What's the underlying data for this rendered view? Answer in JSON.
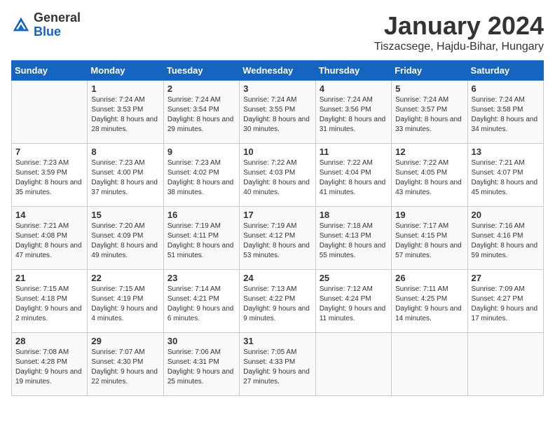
{
  "header": {
    "logo_line1": "General",
    "logo_line2": "Blue",
    "month": "January 2024",
    "location": "Tiszacsege, Hajdu-Bihar, Hungary"
  },
  "weekdays": [
    "Sunday",
    "Monday",
    "Tuesday",
    "Wednesday",
    "Thursday",
    "Friday",
    "Saturday"
  ],
  "weeks": [
    [
      null,
      {
        "day": "1",
        "sunrise": "Sunrise: 7:24 AM",
        "sunset": "Sunset: 3:53 PM",
        "daylight": "Daylight: 8 hours and 28 minutes."
      },
      {
        "day": "2",
        "sunrise": "Sunrise: 7:24 AM",
        "sunset": "Sunset: 3:54 PM",
        "daylight": "Daylight: 8 hours and 29 minutes."
      },
      {
        "day": "3",
        "sunrise": "Sunrise: 7:24 AM",
        "sunset": "Sunset: 3:55 PM",
        "daylight": "Daylight: 8 hours and 30 minutes."
      },
      {
        "day": "4",
        "sunrise": "Sunrise: 7:24 AM",
        "sunset": "Sunset: 3:56 PM",
        "daylight": "Daylight: 8 hours and 31 minutes."
      },
      {
        "day": "5",
        "sunrise": "Sunrise: 7:24 AM",
        "sunset": "Sunset: 3:57 PM",
        "daylight": "Daylight: 8 hours and 33 minutes."
      },
      {
        "day": "6",
        "sunrise": "Sunrise: 7:24 AM",
        "sunset": "Sunset: 3:58 PM",
        "daylight": "Daylight: 8 hours and 34 minutes."
      }
    ],
    [
      {
        "day": "7",
        "sunrise": "Sunrise: 7:23 AM",
        "sunset": "Sunset: 3:59 PM",
        "daylight": "Daylight: 8 hours and 35 minutes."
      },
      {
        "day": "8",
        "sunrise": "Sunrise: 7:23 AM",
        "sunset": "Sunset: 4:00 PM",
        "daylight": "Daylight: 8 hours and 37 minutes."
      },
      {
        "day": "9",
        "sunrise": "Sunrise: 7:23 AM",
        "sunset": "Sunset: 4:02 PM",
        "daylight": "Daylight: 8 hours and 38 minutes."
      },
      {
        "day": "10",
        "sunrise": "Sunrise: 7:22 AM",
        "sunset": "Sunset: 4:03 PM",
        "daylight": "Daylight: 8 hours and 40 minutes."
      },
      {
        "day": "11",
        "sunrise": "Sunrise: 7:22 AM",
        "sunset": "Sunset: 4:04 PM",
        "daylight": "Daylight: 8 hours and 41 minutes."
      },
      {
        "day": "12",
        "sunrise": "Sunrise: 7:22 AM",
        "sunset": "Sunset: 4:05 PM",
        "daylight": "Daylight: 8 hours and 43 minutes."
      },
      {
        "day": "13",
        "sunrise": "Sunrise: 7:21 AM",
        "sunset": "Sunset: 4:07 PM",
        "daylight": "Daylight: 8 hours and 45 minutes."
      }
    ],
    [
      {
        "day": "14",
        "sunrise": "Sunrise: 7:21 AM",
        "sunset": "Sunset: 4:08 PM",
        "daylight": "Daylight: 8 hours and 47 minutes."
      },
      {
        "day": "15",
        "sunrise": "Sunrise: 7:20 AM",
        "sunset": "Sunset: 4:09 PM",
        "daylight": "Daylight: 8 hours and 49 minutes."
      },
      {
        "day": "16",
        "sunrise": "Sunrise: 7:19 AM",
        "sunset": "Sunset: 4:11 PM",
        "daylight": "Daylight: 8 hours and 51 minutes."
      },
      {
        "day": "17",
        "sunrise": "Sunrise: 7:19 AM",
        "sunset": "Sunset: 4:12 PM",
        "daylight": "Daylight: 8 hours and 53 minutes."
      },
      {
        "day": "18",
        "sunrise": "Sunrise: 7:18 AM",
        "sunset": "Sunset: 4:13 PM",
        "daylight": "Daylight: 8 hours and 55 minutes."
      },
      {
        "day": "19",
        "sunrise": "Sunrise: 7:17 AM",
        "sunset": "Sunset: 4:15 PM",
        "daylight": "Daylight: 8 hours and 57 minutes."
      },
      {
        "day": "20",
        "sunrise": "Sunrise: 7:16 AM",
        "sunset": "Sunset: 4:16 PM",
        "daylight": "Daylight: 8 hours and 59 minutes."
      }
    ],
    [
      {
        "day": "21",
        "sunrise": "Sunrise: 7:15 AM",
        "sunset": "Sunset: 4:18 PM",
        "daylight": "Daylight: 9 hours and 2 minutes."
      },
      {
        "day": "22",
        "sunrise": "Sunrise: 7:15 AM",
        "sunset": "Sunset: 4:19 PM",
        "daylight": "Daylight: 9 hours and 4 minutes."
      },
      {
        "day": "23",
        "sunrise": "Sunrise: 7:14 AM",
        "sunset": "Sunset: 4:21 PM",
        "daylight": "Daylight: 9 hours and 6 minutes."
      },
      {
        "day": "24",
        "sunrise": "Sunrise: 7:13 AM",
        "sunset": "Sunset: 4:22 PM",
        "daylight": "Daylight: 9 hours and 9 minutes."
      },
      {
        "day": "25",
        "sunrise": "Sunrise: 7:12 AM",
        "sunset": "Sunset: 4:24 PM",
        "daylight": "Daylight: 9 hours and 11 minutes."
      },
      {
        "day": "26",
        "sunrise": "Sunrise: 7:11 AM",
        "sunset": "Sunset: 4:25 PM",
        "daylight": "Daylight: 9 hours and 14 minutes."
      },
      {
        "day": "27",
        "sunrise": "Sunrise: 7:09 AM",
        "sunset": "Sunset: 4:27 PM",
        "daylight": "Daylight: 9 hours and 17 minutes."
      }
    ],
    [
      {
        "day": "28",
        "sunrise": "Sunrise: 7:08 AM",
        "sunset": "Sunset: 4:28 PM",
        "daylight": "Daylight: 9 hours and 19 minutes."
      },
      {
        "day": "29",
        "sunrise": "Sunrise: 7:07 AM",
        "sunset": "Sunset: 4:30 PM",
        "daylight": "Daylight: 9 hours and 22 minutes."
      },
      {
        "day": "30",
        "sunrise": "Sunrise: 7:06 AM",
        "sunset": "Sunset: 4:31 PM",
        "daylight": "Daylight: 9 hours and 25 minutes."
      },
      {
        "day": "31",
        "sunrise": "Sunrise: 7:05 AM",
        "sunset": "Sunset: 4:33 PM",
        "daylight": "Daylight: 9 hours and 27 minutes."
      },
      null,
      null,
      null
    ]
  ]
}
